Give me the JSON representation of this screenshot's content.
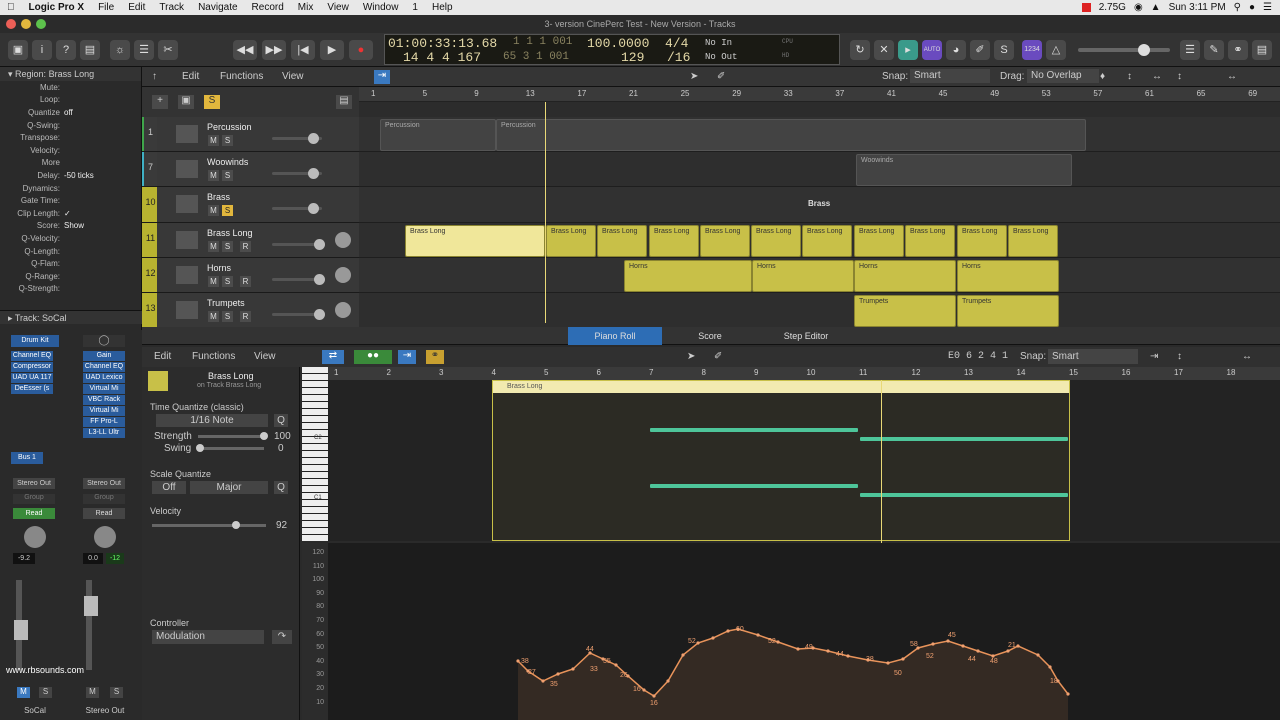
{
  "menubar": {
    "app": "Logic Pro X",
    "items": [
      "File",
      "Edit",
      "Track",
      "Navigate",
      "Record",
      "Mix",
      "View",
      "Window",
      "1",
      "Help"
    ],
    "memory": "2.75G",
    "clock": "Sun 3:11 PM"
  },
  "window": {
    "title": "3- version CinePerc Test - New Version - Tracks"
  },
  "lcd": {
    "time": "01:00:33:13.68",
    "bars": "14 4 4 167",
    "sub1": "1 1 1 001",
    "sub2": "65 3 1 001",
    "tempo": "100.0000",
    "key": "129",
    "sig": "4/4",
    "div": "/16",
    "in": "No In",
    "out": "No Out",
    "cpu": "CPU",
    "hd": "HD"
  },
  "toolbar": {
    "count_in": "1234",
    "auto": "AUTO"
  },
  "inspector": {
    "region_label": "Region:",
    "region_name": "Brass Long",
    "rows": [
      {
        "k": "Mute:",
        "v": ""
      },
      {
        "k": "Loop:",
        "v": ""
      },
      {
        "k": "Quantize",
        "v": "off"
      },
      {
        "k": "Q-Swing:",
        "v": ""
      },
      {
        "k": "Transpose:",
        "v": ""
      },
      {
        "k": "Velocity:",
        "v": ""
      },
      {
        "k": "More",
        "v": ""
      },
      {
        "k": "Delay:",
        "v": "-50 ticks"
      },
      {
        "k": "Dynamics:",
        "v": ""
      },
      {
        "k": "Gate Time:",
        "v": ""
      },
      {
        "k": "Clip Length:",
        "v": "✓"
      },
      {
        "k": "Score:",
        "v": "Show"
      },
      {
        "k": "Q-Velocity:",
        "v": ""
      },
      {
        "k": "Q-Length:",
        "v": ""
      },
      {
        "k": "Q-Flam:",
        "v": ""
      },
      {
        "k": "Q-Range:",
        "v": ""
      },
      {
        "k": "Q-Strength:",
        "v": ""
      }
    ],
    "track_label": "Track:",
    "track_name": "SoCal"
  },
  "tracks_toolbar": {
    "edit": "Edit",
    "functions": "Functions",
    "view": "View",
    "snap_label": "Snap:",
    "snap": "Smart",
    "drag_label": "Drag:",
    "drag": "No Overlap"
  },
  "ruler": [
    "1",
    "5",
    "9",
    "13",
    "17",
    "21",
    "25",
    "29",
    "33",
    "37",
    "41",
    "45",
    "49",
    "53",
    "57",
    "61",
    "65",
    "69"
  ],
  "tracks": [
    {
      "num": "1",
      "name": "Percussion",
      "color": "#3fa64a",
      "regions": [
        "Percussion",
        "Percussion"
      ]
    },
    {
      "num": "7",
      "name": "Woowinds",
      "color": "#3fb0c4",
      "regions": [
        "Woowinds"
      ]
    },
    {
      "num": "10",
      "name": "Brass",
      "color": "#b8b330",
      "folder": "Brass"
    },
    {
      "num": "11",
      "name": "Brass Long",
      "color": "#b8b330",
      "regions": [
        "Brass Long",
        "Brass Long",
        "Brass Long",
        "Brass Long",
        "Brass Long",
        "Brass Long",
        "Brass Long",
        "Brass Long",
        "Brass Long",
        "Brass Long",
        "Brass Long"
      ]
    },
    {
      "num": "12",
      "name": "Horns",
      "color": "#b8b330",
      "regions": [
        "Horns",
        "Horns",
        "Horns",
        "Horns"
      ]
    },
    {
      "num": "13",
      "name": "Trumpets",
      "color": "#b8b330",
      "regions": [
        "Trumpets",
        "Trumpets"
      ]
    }
  ],
  "mixer": {
    "ch1": {
      "name": "Drum Kit",
      "plugins": [
        "Channel EQ",
        "Compressor",
        "UAD UA 117",
        "DeEsser (s"
      ],
      "send": "Bus 1",
      "out": "Stereo Out",
      "group": "Group",
      "auto": "Read",
      "pan": "-9.2",
      "label": "SoCal"
    },
    "ch2": {
      "plugins": [
        "Gain",
        "Channel EQ",
        "UAD Lexico",
        "Virtual Mi",
        "VBC Rack",
        "Virtual Mi",
        "FF Pro-L",
        "L3-LL Ultr"
      ],
      "out": "Stereo Out",
      "group": "Group",
      "auto": "Read",
      "pan": "0.0",
      "pan2": "-12",
      "label": "Stereo Out"
    },
    "watermark": "www.rbsounds.com"
  },
  "editor": {
    "tabs": [
      "Piano Roll",
      "Score",
      "Step Editor"
    ],
    "edit": "Edit",
    "functions": "Functions",
    "view": "View",
    "pos": "E0  6 2 4 1",
    "snap_label": "Snap:",
    "snap": "Smart",
    "region_name": "Brass Long",
    "region_sub": "on Track Brass Long",
    "tq_label": "Time Quantize (classic)",
    "tq_value": "1/16 Note",
    "q": "Q",
    "strength_label": "Strength",
    "strength": "100",
    "swing_label": "Swing",
    "swing": "0",
    "sq_label": "Scale Quantize",
    "sq_off": "Off",
    "sq_scale": "Major",
    "vel_label": "Velocity",
    "vel": "92",
    "ctrl_label": "Controller",
    "ctrl": "Modulation",
    "ruler": [
      "1",
      "2",
      "3",
      "4",
      "5",
      "6",
      "7",
      "8",
      "9",
      "10",
      "11",
      "12",
      "13",
      "14",
      "15",
      "16",
      "17",
      "18"
    ],
    "c2": "C2",
    "c1": "C1",
    "vel_axis": [
      "120",
      "110",
      "100",
      "90",
      "80",
      "70",
      "60",
      "50",
      "40",
      "30",
      "20",
      "10"
    ],
    "curve_labels": [
      "38",
      "27",
      "35",
      "44",
      "33",
      "35",
      "26",
      "16",
      "16",
      "52",
      "60",
      "52",
      "49",
      "44",
      "38",
      "50",
      "58",
      "52",
      "45",
      "44",
      "48",
      "21",
      "18"
    ]
  }
}
